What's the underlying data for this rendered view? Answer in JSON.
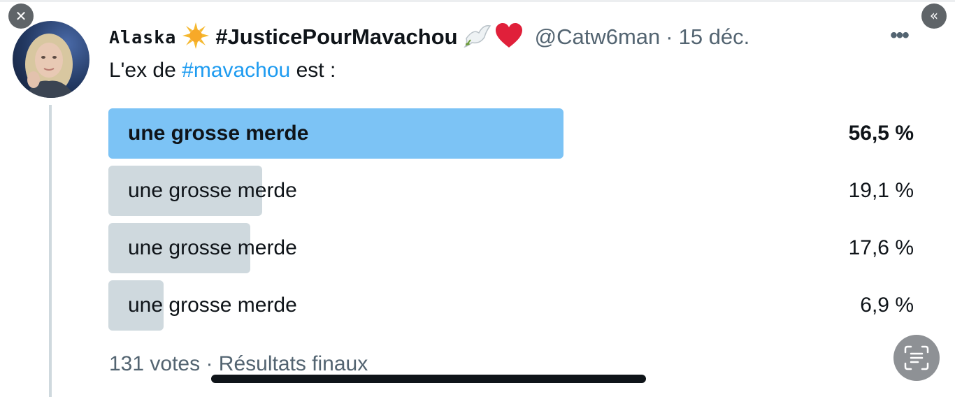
{
  "tweet": {
    "author_name": "Alaska",
    "author_name_emoji": "sun-emoji",
    "author_tag": "#JusticePourMavachou",
    "author_tag_emojis": [
      "dove-emoji",
      "red-heart-emoji"
    ],
    "handle": "@Catw6man",
    "separator": "·",
    "date": "15 déc.",
    "more_label": "•••",
    "text_prefix": "L'ex de ",
    "text_hashtag": "#mavachou",
    "text_suffix": " est :"
  },
  "poll": {
    "options": [
      {
        "label": "une grosse merde",
        "percent_text": "56,5 %",
        "percent": 56.5,
        "winner": true
      },
      {
        "label": "une grosse merde",
        "percent_text": "19,1 %",
        "percent": 19.1,
        "winner": false
      },
      {
        "label": "une grosse merde",
        "percent_text": "17,6 %",
        "percent": 17.6,
        "winner": false
      },
      {
        "label": "une grosse merde",
        "percent_text": "6,9 %",
        "percent": 6.9,
        "winner": false
      }
    ],
    "votes": "131 votes",
    "separator": "·",
    "status": "Résultats finaux"
  },
  "overlay": {
    "close_icon": "close-icon",
    "collapse_icon": "double-chevron-left-icon",
    "scan_icon": "text-scan-icon"
  },
  "colors": {
    "winner_bar": "#7cc3f5",
    "bar": "#cfd9de",
    "hashtag": "#1d9bf0",
    "secondary_text": "#536471",
    "primary_text": "#0f1419"
  }
}
